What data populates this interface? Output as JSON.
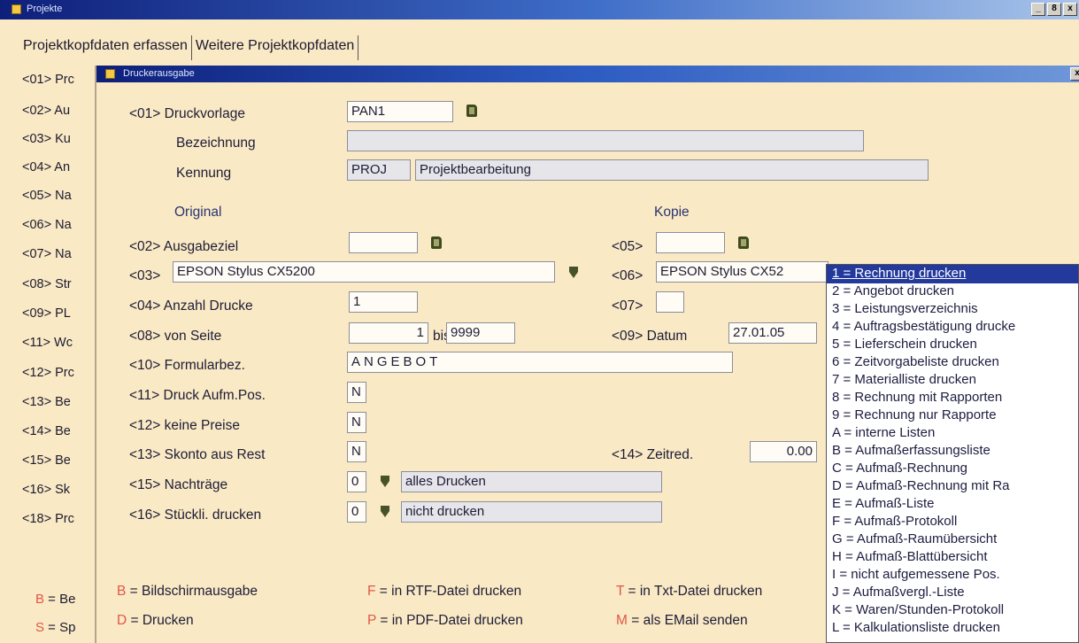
{
  "window": {
    "title": "Projekte",
    "buttons": [
      "_",
      "8",
      "x"
    ]
  },
  "tabs": [
    "Projektkopfdaten erfassen",
    "Weitere Projektkopfdaten"
  ],
  "left_list": [
    "<01> Prc",
    "<02> Au",
    "<03> Ku",
    "<04> An",
    "<05> Na",
    "<06> Na",
    "<07> Na",
    "<08> Str",
    "<09> PL",
    "<11> Wc",
    "<12> Prc",
    "<13> Be",
    "<14> Be",
    "<15> Be",
    "<16> Sk",
    "<18> Prc"
  ],
  "left_legend": [
    {
      "key": "B",
      "text": " = Be"
    },
    {
      "key": "S",
      "text": " = Sp"
    }
  ],
  "dialog": {
    "title": "Druckerausgabe",
    "close_button": "x",
    "druckvorlage": {
      "label": "<01> Druckvorlage",
      "value": "PAN1"
    },
    "bezeichnung": {
      "label": "Bezeichnung",
      "value": ""
    },
    "kennung": {
      "label": "Kennung",
      "code": "PROJ",
      "value": "Projektbearbeitung"
    },
    "original_heading": "Original",
    "kopie_heading": "Kopie",
    "ausgabeziel": {
      "label": "<02> Ausgabeziel",
      "value": ""
    },
    "drucker": {
      "label": "<03>",
      "value": "EPSON Stylus CX5200"
    },
    "anzahl": {
      "label": "<04> Anzahl Drucke",
      "value": "1"
    },
    "von_seite": {
      "label": "<08> von Seite",
      "from": "1",
      "bis_label": "bis",
      "to": "9999"
    },
    "formularbez": {
      "label": "<10> Formularbez.",
      "value": "ANGEBOT"
    },
    "druck_aufm": {
      "label": "<11> Druck Aufm.Pos.",
      "value": "N"
    },
    "keine_preise": {
      "label": "<12> keine Preise",
      "value": "N"
    },
    "skonto": {
      "label": "<13> Skonto aus Rest",
      "value": "N"
    },
    "nachtraege": {
      "label": "<15> Nachträge",
      "code": "0",
      "value": "alles Drucken"
    },
    "stueckli": {
      "label": "<16> Stückli. drucken",
      "code": "0",
      "value": "nicht drucken"
    },
    "kopie_ziel": {
      "label": "<05>",
      "value": ""
    },
    "kopie_drucker": {
      "label": "<06>",
      "value": "EPSON Stylus CX52"
    },
    "kopie_anzahl": {
      "label": "<07>",
      "value": ""
    },
    "datum": {
      "label": "<09> Datum",
      "value": "27.01.05"
    },
    "zeitred": {
      "label": "<14> Zeitred.",
      "value": "0.00"
    },
    "legend": [
      {
        "key": "B",
        "text": " = Bildschirmausgabe"
      },
      {
        "key": "D",
        "text": " = Drucken"
      },
      {
        "key": "F",
        "text": " = in RTF-Datei drucken"
      },
      {
        "key": "P",
        "text": " = in PDF-Datei drucken"
      },
      {
        "key": "T",
        "text": " = in Txt-Datei drucken"
      },
      {
        "key": "M",
        "text": " = als EMail senden"
      }
    ]
  },
  "dropdown": {
    "selected_index": 0,
    "items": [
      "1 = Rechnung drucken",
      "2 = Angebot drucken",
      "3 = Leistungsverzeichnis",
      "4 = Auftragsbestätigung drucke",
      "5 = Lieferschein drucken",
      "6 = Zeitvorgabeliste drucken",
      "7 = Materialliste drucken",
      "8 = Rechnung mit Rapporten",
      "9 = Rechnung nur Rapporte",
      "A = interne Listen",
      "B = Aufmaßerfassungsliste",
      "C = Aufmaß-Rechnung",
      "D = Aufmaß-Rechnung mit Ra",
      "E = Aufmaß-Liste",
      "F = Aufmaß-Protokoll",
      "G = Aufmaß-Raumübersicht",
      "H = Aufmaß-Blattübersicht",
      "I = nicht aufgemessene Pos.",
      "J = Aufmaßvergl.-Liste",
      "K = Waren/Stunden-Protokoll",
      "L = Kalkulationsliste drucken"
    ]
  },
  "colors": {
    "background": "#fae9c5",
    "accent": "#233a9c",
    "key_red": "#e0574a"
  }
}
